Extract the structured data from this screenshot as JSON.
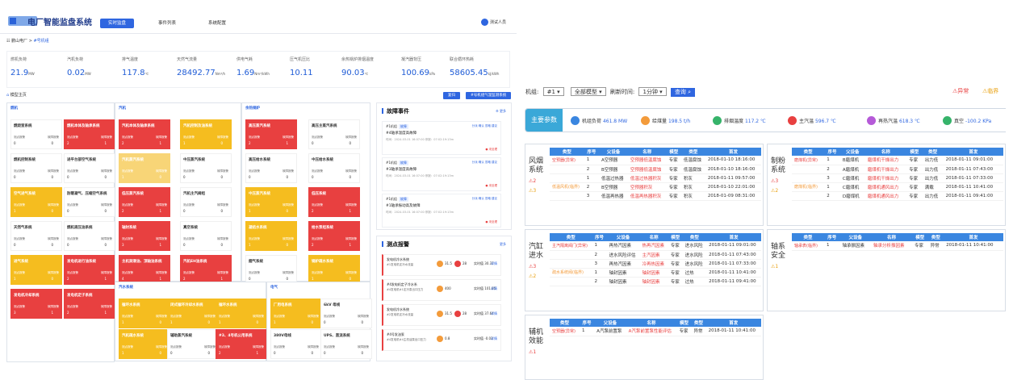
{
  "left": {
    "title": "电厂智能监盘系统",
    "tabs": [
      "实时监盘",
      "事件列表",
      "系统配置"
    ],
    "user": "测试人员",
    "breadcrumb": {
      "root": "鹏山电厂",
      "sep": "> ",
      "cur": "#号机组"
    },
    "kpis": [
      {
        "label": "燃机负荷",
        "value": "21.9",
        "unit": "MW"
      },
      {
        "label": "汽机负荷",
        "value": "0.02",
        "unit": "MW"
      },
      {
        "label": "排气温度",
        "value": "117.8",
        "unit": "℃"
      },
      {
        "label": "天然气流量",
        "value": "28492.77",
        "unit": "Nm³/h"
      },
      {
        "label": "供电气耗",
        "value": "1.69",
        "unit": "Nm³/kWh"
      },
      {
        "label": "压气机压比",
        "value": "10.11",
        "unit": ""
      },
      {
        "label": "余热锅炉排烟温度",
        "value": "90.03",
        "unit": "℃"
      },
      {
        "label": "凝汽器背压",
        "value": "100.69",
        "unit": "kPa"
      },
      {
        "label": "联合循环热耗",
        "value": "58605.45",
        "unit": "kJ/kWh"
      }
    ],
    "home": "模型主页",
    "btn_reset": "复归",
    "btn_query": "#号机组气温监测系统",
    "groups": [
      {
        "title": "燃机",
        "cards": [
          {
            "name": "燃烧室系统",
            "a": "测点报警",
            "b": "故障报警",
            "a2": "0",
            "b2": "0",
            "c": "w"
          },
          {
            "name": "燃机本体及轴承系统",
            "a": "测点报警",
            "b": "故障报警",
            "a2": "2",
            "b2": "1",
            "c": "r"
          },
          {
            "name": "燃机控制系统",
            "a": "测点报警",
            "b": "故障报警",
            "a2": "0",
            "b2": "0",
            "c": "w"
          },
          {
            "name": "进平台部空气系统",
            "a": "测点报警",
            "b": "故障报警",
            "a2": "0",
            "b2": "0",
            "c": "w"
          },
          {
            "name": "空气进气系统",
            "a": "测点报警",
            "b": "故障报警",
            "a2": "1",
            "b2": "0",
            "c": "y"
          },
          {
            "name": "防暖凝气、压缩空气系统",
            "a": "测点报警",
            "b": "故障报警",
            "a2": "0",
            "b2": "0",
            "c": "w"
          },
          {
            "name": "天然气系统",
            "a": "测点报警",
            "b": "故障报警",
            "a2": "0",
            "b2": "0",
            "c": "w"
          },
          {
            "name": "燃机液压油系统",
            "a": "测点报警",
            "b": "故障报警",
            "a2": "0",
            "b2": "0",
            "c": "w"
          },
          {
            "name": "进气系统",
            "a": "测点报警",
            "b": "故障报警",
            "a2": "1",
            "b2": "0",
            "c": "y"
          },
          {
            "name": "发电机进行油系统",
            "a": "测点报警",
            "b": "故障报警",
            "a2": "2",
            "b2": "1",
            "c": "r"
          },
          {
            "name": "发电机冷却系统",
            "a": "测点报警",
            "b": "故障报警",
            "a2": "3",
            "b2": "1",
            "c": "r"
          },
          {
            "name": "发电机定子系统",
            "a": "测点报警",
            "b": "故障报警",
            "a2": "2",
            "b2": "1",
            "c": "r"
          }
        ]
      },
      {
        "title": "汽机",
        "cards": [
          {
            "name": "汽机本体及轴承系统",
            "a": "测点报警",
            "b": "故障报警",
            "a2": "2",
            "b2": "1",
            "c": "r"
          },
          {
            "name": "汽机控制及油系统",
            "a": "测点报警",
            "b": "故障报警",
            "a2": "1",
            "b2": "0",
            "c": "y"
          },
          {
            "name": "汽机蒸汽系统",
            "a": "测点报警",
            "b": "故障报警",
            "a2": "1",
            "b2": "0",
            "c": "ly"
          },
          {
            "name": "中压蒸汽系统",
            "a": "测点报警",
            "b": "故障报警",
            "a2": "0",
            "b2": "0",
            "c": "w"
          },
          {
            "name": "低压蒸汽系统",
            "a": "测点报警",
            "b": "故障报警",
            "a2": "2",
            "b2": "1",
            "c": "r"
          },
          {
            "name": "汽机主汽阀组",
            "a": "测点报警",
            "b": "故障报警",
            "a2": "0",
            "b2": "0",
            "c": "w"
          },
          {
            "name": "轴封系统",
            "a": "测点报警",
            "b": "故障报警",
            "a2": "3",
            "b2": "1",
            "c": "r"
          },
          {
            "name": "真空系统",
            "a": "测点报警",
            "b": "故障报警",
            "a2": "0",
            "b2": "0",
            "c": "w"
          },
          {
            "name": "主机润滑油、顶轴油系统",
            "a": "测点报警",
            "b": "故障报警",
            "a2": "4",
            "b2": "1",
            "c": "r"
          },
          {
            "name": "汽机EH油系统",
            "a": "测点报警",
            "b": "故障报警",
            "a2": "2",
            "b2": "1",
            "c": "r"
          }
        ]
      },
      {
        "title": "余热锅炉",
        "cards": [
          {
            "name": "高压蒸汽系统",
            "a": "测点报警",
            "b": "故障报警",
            "a2": "2",
            "b2": "1",
            "c": "r"
          },
          {
            "name": "高压主蒸汽系统",
            "a": "测点报警",
            "b": "故障报警",
            "a2": "0",
            "b2": "0",
            "c": "w"
          },
          {
            "name": "高压给水系统",
            "a": "测点报警",
            "b": "故障报警",
            "a2": "0",
            "b2": "0",
            "c": "w"
          },
          {
            "name": "中压给水系统",
            "a": "测点报警",
            "b": "故障报警",
            "a2": "0",
            "b2": "0",
            "c": "w"
          },
          {
            "name": "中压蒸汽系统",
            "a": "测点报警",
            "b": "故障报警",
            "a2": "1",
            "b2": "0",
            "c": "y"
          },
          {
            "name": "低压系统",
            "a": "测点报警",
            "b": "故障报警",
            "a2": "2",
            "b2": "1",
            "c": "r"
          },
          {
            "name": "凝结水系统",
            "a": "测点报警",
            "b": "故障报警",
            "a2": "1",
            "b2": "0",
            "c": "y"
          },
          {
            "name": "给水泵组系统",
            "a": "测点报警",
            "b": "故障报警",
            "a2": "2",
            "b2": "1",
            "c": "r"
          },
          {
            "name": "烟气系统",
            "a": "测点报警",
            "b": "故障报警",
            "a2": "0",
            "b2": "0",
            "c": "w"
          },
          {
            "name": "锅炉疏水系统",
            "a": "测点报警",
            "b": "故障报警",
            "a2": "1",
            "b2": "0",
            "c": "y"
          }
        ]
      },
      {
        "title": "汽水系统",
        "cards": [
          {
            "name": "循环水系统",
            "a": "测点报警",
            "b": "故障报警",
            "a2": "1",
            "b2": "0",
            "c": "y"
          },
          {
            "name": "闭式循环冷却水系统",
            "a": "测点报警",
            "b": "故障报警",
            "a2": "1",
            "b2": "0",
            "c": "y"
          },
          {
            "name": "循环水系统",
            "a": "测点报警",
            "b": "故障报警",
            "a2": "1",
            "b2": "0",
            "c": "y"
          },
          {
            "name": "汽机疏水系统",
            "a": "测点报警",
            "b": "故障报警",
            "a2": "1",
            "b2": "0",
            "c": "y"
          },
          {
            "name": "辅助蒸汽系统",
            "a": "测点报警",
            "b": "故障报警",
            "a2": "0",
            "b2": "0",
            "c": "w"
          },
          {
            "name": "#3、4号机公用系统",
            "a": "测点报警",
            "b": "故障报警",
            "a2": "2",
            "b2": "1",
            "c": "r"
          }
        ]
      },
      {
        "title": "电气",
        "cards": [
          {
            "name": "厂用电系统",
            "a": "测点报警",
            "b": "故障报警",
            "a2": "1",
            "b2": "0",
            "c": "y"
          },
          {
            "name": "6kV 母线",
            "a": "测点报警",
            "b": "故障报警",
            "a2": "0",
            "b2": "0",
            "c": "w"
          },
          {
            "name": "380V母线",
            "a": "测点报警",
            "b": "故障报警",
            "a2": "0",
            "b2": "0",
            "c": "w"
          },
          {
            "name": "UPS、直流系统",
            "a": "测点报警",
            "b": "故障报警",
            "a2": "0",
            "b2": "0",
            "c": "w"
          }
        ]
      }
    ],
    "events_title": "故障事件",
    "events_more": "更多",
    "events": [
      {
        "tag": "#1机组",
        "type": "故障",
        "desc": "#4轴承温度高故障",
        "meta": "时间：2024-03-01 16:07:00  停报：07:02:19:13m",
        "ops": "分派  确认  忽略  建议",
        "status": "● 未处理"
      },
      {
        "tag": "#1机组",
        "type": "故障",
        "desc": "#3轴承温度高故障",
        "meta": "时间：2024-03-01 16:07:00  停报：07:02:19:13m",
        "ops": "分派  确认  忽略  建议",
        "status": "● 未处理"
      },
      {
        "tag": "#1机组",
        "type": "故障",
        "desc": "#1轴承振动高及故障",
        "meta": "时间：2024-03-01 16:07:00  停报：07:02:19:13m",
        "ops": "分派  确认  忽略  建议",
        "status": "● 未处理"
      }
    ],
    "alarms_title": "测点报警",
    "alarms_more": "更多",
    "alarms": [
      {
        "dev": "发电机冷水系统",
        "sub": "#1发电机定冷水流量",
        "v1": "31.5",
        "v2": "28",
        "rv": "实时值 30.37",
        "k": "详情"
      },
      {
        "dev": "#4发电机定子冷水系",
        "sub": "#4发电机#1定冷泵出口压力",
        "v1": "400",
        "v2": "",
        "rv": "实时值 101.85",
        "k": "详情"
      },
      {
        "dev": "发电机冷水系统",
        "sub": "#2发电机定冷水流量",
        "v1": "31.5",
        "v2": "28",
        "rv": "实时值 37.64",
        "k": "详情"
      },
      {
        "dev": "#4号发油泵",
        "sub": "#4发电机#4主机油泵出口压力",
        "v1": "0.8",
        "v2": "",
        "rv": "实时值 -0.02",
        "k": "详情"
      }
    ]
  },
  "right": {
    "toolbar": {
      "unit_label": "机组:",
      "unit": "#1",
      "model": "全部模型",
      "refresh_label": "刷新时间:",
      "refresh": "1分钟",
      "query": "查询"
    },
    "legend": {
      "abnormal": "⚠异常",
      "critical": "⚠临界"
    },
    "params_label": "主要参数",
    "params": [
      {
        "label": "机组负荷",
        "value": "461.8",
        "unit": "MW",
        "color": "#3a86e0"
      },
      {
        "label": "给煤量",
        "value": "198.5",
        "unit": "t/h",
        "color": "#f39b3b"
      },
      {
        "label": "排烟温度",
        "value": "117.2",
        "unit": "℃",
        "color": "#36b36a"
      },
      {
        "label": "主汽温",
        "value": "596.7",
        "unit": "℃",
        "color": "#e84040"
      },
      {
        "label": "再热汽温",
        "value": "618.3",
        "unit": "℃",
        "color": "#b55ad8"
      },
      {
        "label": "真空",
        "value": "-100.2",
        "unit": "KPa",
        "color": "#36b36a"
      }
    ],
    "header": [
      "类型",
      "序号",
      "父设备",
      "名称",
      "模型",
      "类型",
      "首发"
    ],
    "sections": [
      {
        "name": "风烟系统",
        "warn": "⚠2",
        "crit": "⚠3",
        "types": [
          "空预器(异常)",
          "低温风机(临界)"
        ],
        "rows": [
          [
            "1",
            "A空预器",
            "空预器低温腐蚀",
            "专家",
            "低温腐蚀",
            "2018-01-10 18:16:00"
          ],
          [
            "2",
            "B空预器",
            "空预器低温腐蚀",
            "专家",
            "低温腐蚀",
            "2018-01-10 18:16:00"
          ],
          [
            "1",
            "低温过热器",
            "低温过热器积灰",
            "专家",
            "积灰",
            "2018-01-11 09:57:00"
          ],
          [
            "2",
            "B空预器",
            "空预器积灰",
            "专家",
            "积灰",
            "2018-01-10 22:01:00"
          ],
          [
            "3",
            "低温再热器",
            "低温再热器积灰",
            "专家",
            "积灰",
            "2018-01-09 08:31:00"
          ]
        ]
      },
      {
        "name": "制粉系统",
        "warn": "⚠3",
        "crit": "⚠2",
        "types": [
          "磨煤机(异常)",
          "磨煤机(临界)"
        ],
        "rows": [
          [
            "1",
            "B磨煤机",
            "磨煤机干燥出力",
            "专家",
            "出力低",
            "2018-01-11 09:01:00"
          ],
          [
            "2",
            "A磨煤机",
            "磨煤机干燥出力",
            "专家",
            "出力低",
            "2018-01-11 07:43:00"
          ],
          [
            "3",
            "C磨煤机",
            "磨煤机干燥出力",
            "专家",
            "出力低",
            "2018-01-11 07:33:00"
          ],
          [
            "1",
            "C磨煤机",
            "磨煤机通风出力",
            "专家",
            "满载",
            "2018-01-11 10:41:00"
          ],
          [
            "2",
            "D磨煤机",
            "磨煤机通风出力",
            "专家",
            "出力低",
            "2018-01-11 09:41:00"
          ]
        ]
      },
      {
        "name": "汽缸进水",
        "warn": "⚠3",
        "crit": "⚠2",
        "types": [
          "主汽隔离阀门(异常)",
          "疏水系统阀(临界)"
        ],
        "rows": [
          [
            "1",
            "再热汽因素",
            "热再汽因素",
            "专家",
            "进水风险",
            "2018-01-11 09:01:00"
          ],
          [
            "2",
            "进水风险评估",
            "主汽因素",
            "专家",
            "进水风险",
            "2018-01-11 07:43:00"
          ],
          [
            "3",
            "再热汽因素",
            "冷再热因素",
            "专家",
            "进水风险",
            "2018-01-11 07:33:00"
          ],
          [
            "1",
            "轴封因素",
            "轴封因素",
            "专家",
            "过热",
            "2018-01-11 10:41:00"
          ],
          [
            "2",
            "轴封因素",
            "轴封因素",
            "专家",
            "过热",
            "2018-01-11 09:41:00"
          ]
        ]
      },
      {
        "name": "轴系安全",
        "warn": "",
        "crit": "⚠1",
        "types": [
          "轴承表(临界)"
        ],
        "rows": [
          [
            "1",
            "轴承振因素",
            "轴承分析振因素",
            "专家",
            "异常",
            "2018-01-11 10:41:00"
          ]
        ]
      },
      {
        "name": "辅机效能",
        "warn": "⚠1",
        "crit": "",
        "types": [
          "空预器(异常)"
        ],
        "rows": [
          [
            "1",
            "A汽泵前置泵",
            "A汽泵前置泵性能评估",
            "专家",
            "异常",
            "2018-01-11 10:41:00"
          ]
        ]
      }
    ]
  }
}
